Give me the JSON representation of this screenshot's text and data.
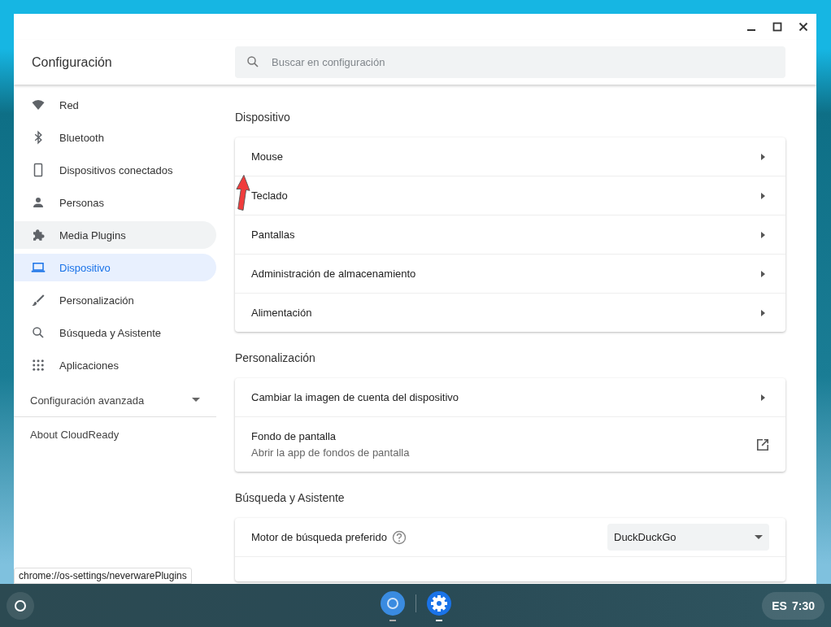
{
  "window": {
    "title": "Configuración",
    "search": {
      "placeholder": "Buscar en configuración"
    }
  },
  "sidebar": {
    "items": [
      {
        "label": "Red",
        "selected": false,
        "hovered": false
      },
      {
        "label": "Bluetooth",
        "selected": false,
        "hovered": false
      },
      {
        "label": "Dispositivos conectados",
        "selected": false,
        "hovered": false
      },
      {
        "label": "Personas",
        "selected": false,
        "hovered": false
      },
      {
        "label": "Media Plugins",
        "selected": false,
        "hovered": true
      },
      {
        "label": "Dispositivo",
        "selected": true,
        "hovered": false
      },
      {
        "label": "Personalización",
        "selected": false,
        "hovered": false
      },
      {
        "label": "Búsqueda y Asistente",
        "selected": false,
        "hovered": false
      },
      {
        "label": "Aplicaciones",
        "selected": false,
        "hovered": false
      }
    ],
    "advanced": {
      "label": "Configuración avanzada",
      "expanded": false
    },
    "about": "About CloudReady"
  },
  "sections": [
    {
      "title": "Dispositivo",
      "rows": [
        {
          "kind": "link",
          "label": "Mouse"
        },
        {
          "kind": "link",
          "label": "Teclado"
        },
        {
          "kind": "link",
          "label": "Pantallas"
        },
        {
          "kind": "link",
          "label": "Administración de almacenamiento"
        },
        {
          "kind": "link",
          "label": "Alimentación"
        }
      ]
    },
    {
      "title": "Personalización",
      "rows": [
        {
          "kind": "link",
          "label": "Cambiar la imagen de cuenta del dispositivo"
        },
        {
          "kind": "external",
          "label": "Fondo de pantalla",
          "sublabel": "Abrir la app de fondos de pantalla"
        }
      ]
    },
    {
      "title": "Búsqueda y Asistente",
      "rows": [
        {
          "kind": "select",
          "label": "Motor de búsqueda preferido",
          "value": "DuckDuckGo"
        }
      ]
    }
  ],
  "status_url": "chrome://os-settings/neverwarePlugins",
  "tray": {
    "language": "ES",
    "time": "7:30"
  }
}
